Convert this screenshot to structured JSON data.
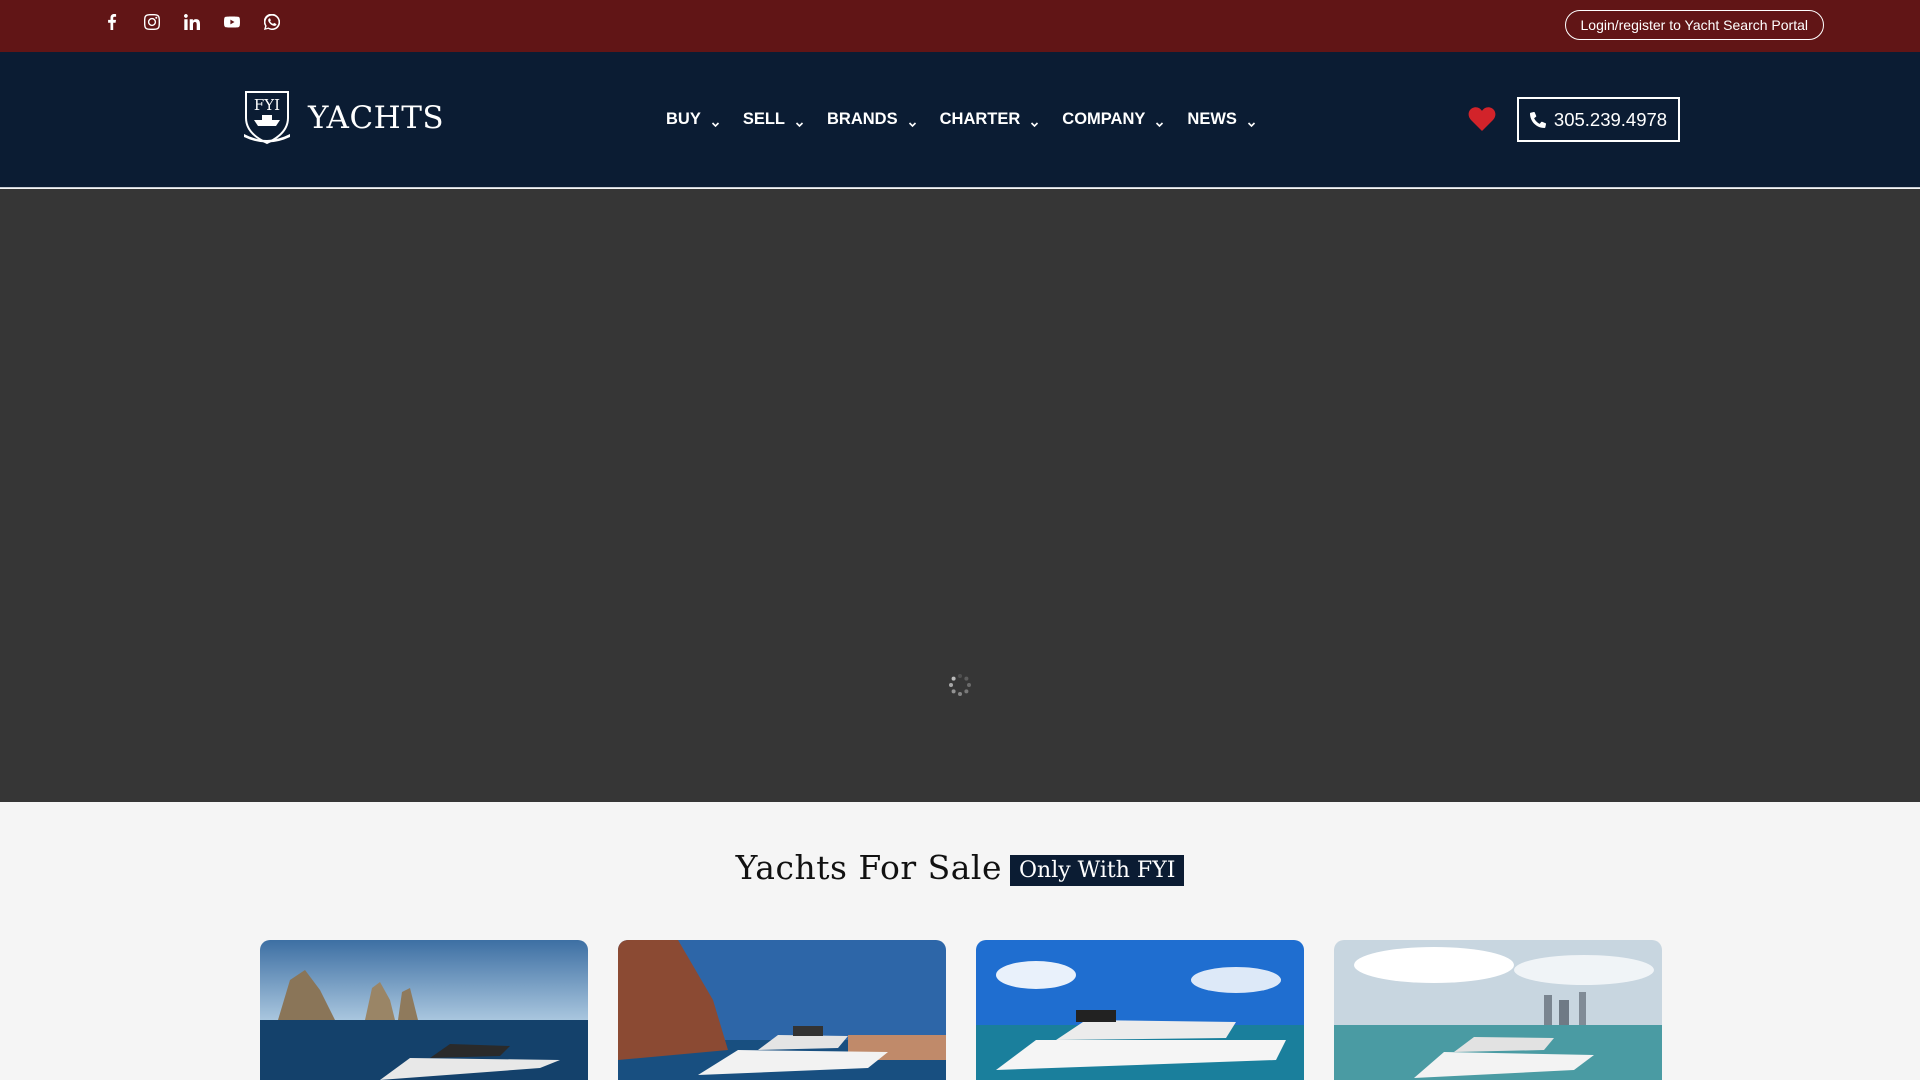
{
  "topbar": {
    "social_icons": [
      "facebook-icon",
      "instagram-icon",
      "linkedin-icon",
      "youtube-icon",
      "whatsapp-icon"
    ],
    "login_label": "Login/register to Yacht Search Portal"
  },
  "header": {
    "logo_mark": "FYI",
    "logo_text": "YACHTS",
    "nav": [
      {
        "label": "BUY"
      },
      {
        "label": "SELL"
      },
      {
        "label": "BRANDS"
      },
      {
        "label": "CHARTER"
      },
      {
        "label": "COMPANY"
      },
      {
        "label": "NEWS"
      }
    ],
    "phone": "305.239.4978"
  },
  "section": {
    "title": "Yachts For Sale",
    "badge": "Only With FYI"
  },
  "colors": {
    "topbar_bg": "#611516",
    "header_bg": "#0b1c33",
    "hero_bg": "#363636",
    "heart": "#d2232a"
  }
}
